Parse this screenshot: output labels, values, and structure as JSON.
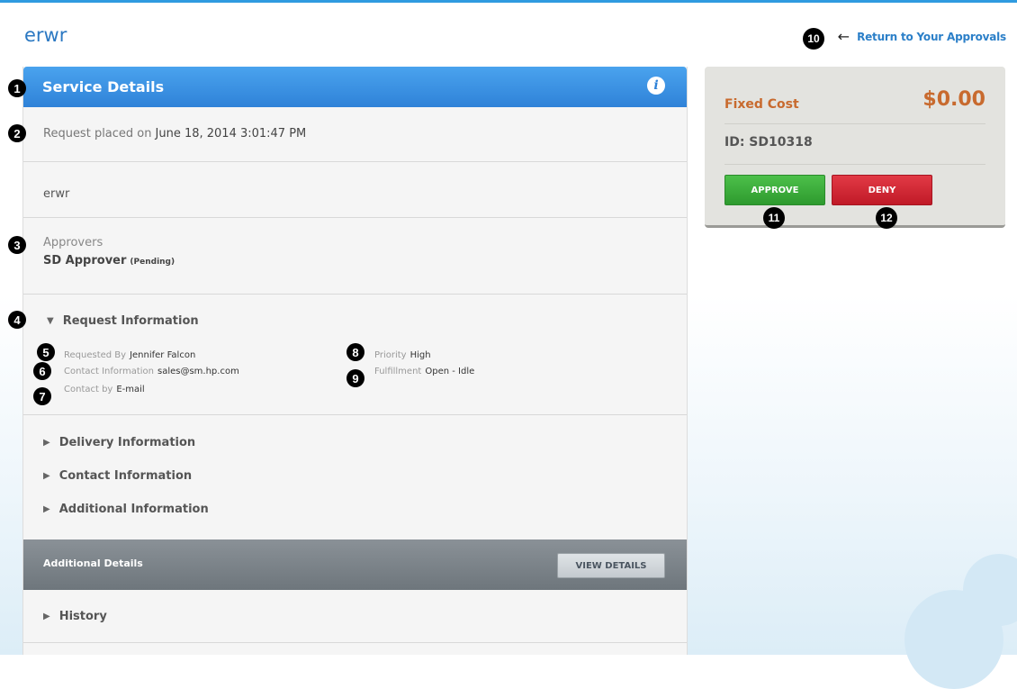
{
  "page": {
    "title": "erwr"
  },
  "nav": {
    "return_label": "Return to Your Approvals",
    "arrow_glyph": "←"
  },
  "service_details": {
    "title": "Service Details",
    "info_glyph": "i",
    "placed_label": "Request placed on",
    "placed_date": "June 18, 2014 3:01:47 PM",
    "description": "erwr",
    "approvers_label": "Approvers",
    "approver_name": "SD Approver",
    "approver_status": "(Pending)"
  },
  "request_information": {
    "title": "Request Information",
    "expanded": true,
    "fields": {
      "requested_by": {
        "label": "Requested By",
        "value": "Jennifer Falcon"
      },
      "contact_information": {
        "label": "Contact Information",
        "value": "sales@sm.hp.com"
      },
      "contact_by": {
        "label": "Contact by",
        "value": "E-mail"
      },
      "priority": {
        "label": "Priority",
        "value": "High"
      },
      "fulfillment": {
        "label": "Fulfillment",
        "value": "Open - Idle"
      }
    }
  },
  "sections": {
    "delivery": "Delivery Information",
    "contact": "Contact Information",
    "additional": "Additional Information"
  },
  "additional_details": {
    "title": "Additional Details",
    "button": "VIEW DETAILS"
  },
  "history": {
    "title": "History"
  },
  "cost_card": {
    "cost_label": "Fixed Cost",
    "cost_value": "$0.00",
    "id_text": "ID: SD10318",
    "approve_label": "APPROVE",
    "deny_label": "DENY"
  },
  "callouts": [
    "1",
    "2",
    "3",
    "4",
    "5",
    "6",
    "7",
    "8",
    "9",
    "10",
    "11",
    "12"
  ],
  "colors": {
    "accent_blue": "#2b78c2",
    "header_blue": "#2f82d8",
    "cost_orange": "#c86a2e",
    "approve_green": "#3aae3a",
    "deny_red": "#d42633"
  }
}
